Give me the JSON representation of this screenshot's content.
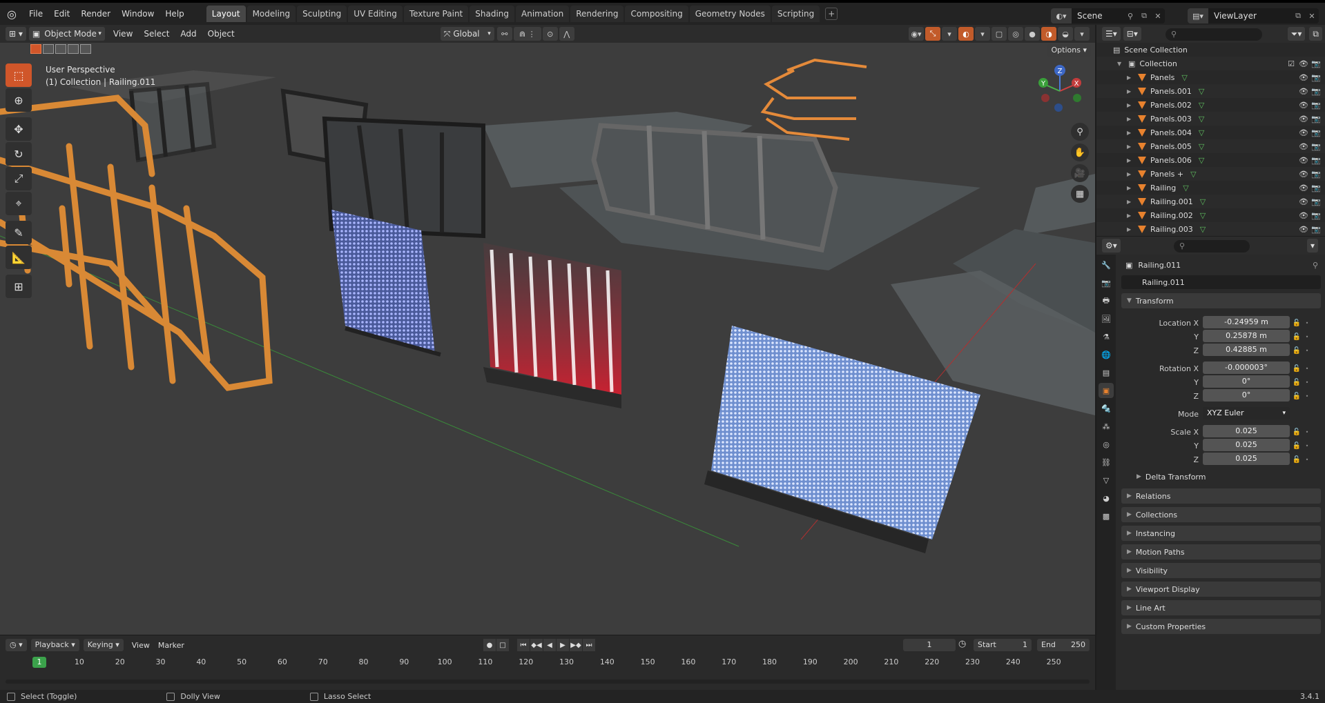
{
  "topbar": {
    "menus": [
      "File",
      "Edit",
      "Render",
      "Window",
      "Help"
    ],
    "workspaces": [
      "Layout",
      "Modeling",
      "Sculpting",
      "UV Editing",
      "Texture Paint",
      "Shading",
      "Animation",
      "Rendering",
      "Compositing",
      "Geometry Nodes",
      "Scripting"
    ],
    "active_workspace": "Layout",
    "scene_name": "Scene",
    "view_layer": "ViewLayer"
  },
  "viewport": {
    "mode": "Object Mode",
    "menus": [
      "View",
      "Select",
      "Add",
      "Object"
    ],
    "orientation": "Global",
    "options_label": "Options",
    "info_line1": "User Perspective",
    "info_line2": "(1) Collection | Railing.011",
    "gizmo_axes": {
      "x": "X",
      "y": "Y",
      "z": "Z"
    }
  },
  "timeline": {
    "playback_label": "Playback",
    "keying_label": "Keying",
    "view_label": "View",
    "marker_label": "Marker",
    "current_frame": "1",
    "start_label": "Start",
    "start_value": "1",
    "end_label": "End",
    "end_value": "250",
    "ruler_ticks": [
      "10",
      "20",
      "30",
      "40",
      "50",
      "60",
      "70",
      "80",
      "90",
      "100",
      "110",
      "120",
      "130",
      "140",
      "150",
      "160",
      "170",
      "180",
      "190",
      "200",
      "210",
      "220",
      "230",
      "240",
      "250"
    ],
    "ruler_current": "1"
  },
  "statusbar": {
    "select": "Select (Toggle)",
    "dolly": "Dolly View",
    "lasso": "Lasso Select",
    "version": "3.4.1"
  },
  "outliner": {
    "scene_collection": "Scene Collection",
    "collection": "Collection",
    "items": [
      "Panels",
      "Panels.001",
      "Panels.002",
      "Panels.003",
      "Panels.004",
      "Panels.005",
      "Panels.006",
      "Panels +",
      "Railing",
      "Railing.001",
      "Railing.002",
      "Railing.003"
    ]
  },
  "properties": {
    "object_name": "Railing.011",
    "object_field": "Railing.011",
    "transform_label": "Transform",
    "location_label": "Location X",
    "location": [
      "-0.24959 m",
      "0.25878 m",
      "0.42885 m"
    ],
    "rotation_label": "Rotation X",
    "rotation": [
      "-0.000003°",
      "0°",
      "0°"
    ],
    "mode_label": "Mode",
    "mode_value": "XYZ Euler",
    "scale_label": "Scale X",
    "scale": [
      "0.025",
      "0.025",
      "0.025"
    ],
    "axis_y": "Y",
    "axis_z": "Z",
    "delta_transform": "Delta Transform",
    "panels": [
      "Relations",
      "Collections",
      "Instancing",
      "Motion Paths",
      "Visibility",
      "Viewport Display",
      "Line Art",
      "Custom Properties"
    ]
  },
  "colors": {
    "accent_orange": "#e8822e",
    "active_tool": "#d0562a",
    "frame_green": "#3ba24b",
    "viewport_bg": "#3d3d3d"
  }
}
